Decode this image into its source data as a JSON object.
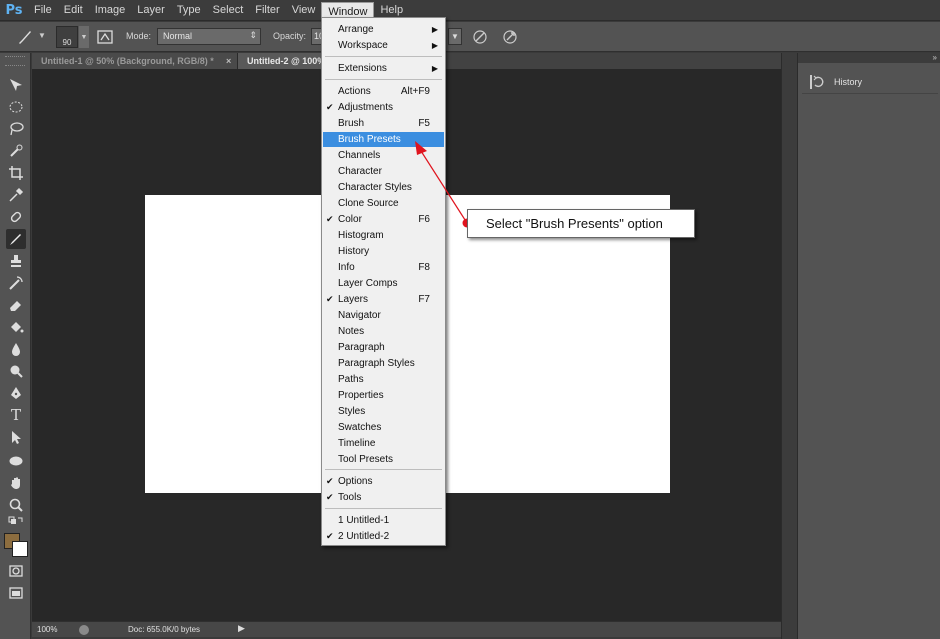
{
  "app": {
    "logo": "Ps"
  },
  "menubar": {
    "items": [
      "File",
      "Edit",
      "Image",
      "Layer",
      "Type",
      "Select",
      "Filter",
      "View",
      "Window",
      "Help"
    ],
    "open_menu": "Window"
  },
  "options_bar": {
    "brush_size": "90",
    "mode_label": "Mode:",
    "mode_value": "Normal",
    "opacity_label": "Opacity:",
    "opacity_value": "10"
  },
  "tabs": [
    {
      "label": "Untitled-1 @ 50% (Background, RGB/8) *",
      "close": "×",
      "active": false
    },
    {
      "label": "Untitled-2 @ 100%",
      "active": true
    }
  ],
  "status_bar": {
    "zoom": "100%",
    "doc_size": "Doc: 655.0K/0 bytes"
  },
  "panel": {
    "history_label": "History"
  },
  "window_menu": {
    "items": [
      {
        "label": "Arrange",
        "submenu": true
      },
      {
        "label": "Workspace",
        "submenu": true
      },
      {
        "label": "Extensions",
        "submenu": true
      },
      {
        "label": "Actions",
        "shortcut": "Alt+F9"
      },
      {
        "label": "Adjustments",
        "checked": true
      },
      {
        "label": "Brush",
        "shortcut": "F5"
      },
      {
        "label": "Brush Presets",
        "highlighted": true
      },
      {
        "label": "Channels"
      },
      {
        "label": "Character"
      },
      {
        "label": "Character Styles"
      },
      {
        "label": "Clone Source"
      },
      {
        "label": "Color",
        "shortcut": "F6",
        "checked": true
      },
      {
        "label": "Histogram"
      },
      {
        "label": "History"
      },
      {
        "label": "Info",
        "shortcut": "F8"
      },
      {
        "label": "Layer Comps"
      },
      {
        "label": "Layers",
        "shortcut": "F7",
        "checked": true
      },
      {
        "label": "Navigator"
      },
      {
        "label": "Notes"
      },
      {
        "label": "Paragraph"
      },
      {
        "label": "Paragraph Styles"
      },
      {
        "label": "Paths"
      },
      {
        "label": "Properties"
      },
      {
        "label": "Styles"
      },
      {
        "label": "Swatches"
      },
      {
        "label": "Timeline"
      },
      {
        "label": "Tool Presets"
      },
      {
        "label": "Options",
        "checked": true
      },
      {
        "label": "Tools",
        "checked": true
      },
      {
        "label": "1 Untitled-1"
      },
      {
        "label": "2 Untitled-2",
        "checked": true
      }
    ]
  },
  "annotation": {
    "text": "Select \"Brush Presents\" option"
  },
  "colors": {
    "foreground": "#8c6d3f",
    "background": "#ffffff",
    "highlight": "#3b8ee0",
    "arrow": "#e0141e"
  }
}
